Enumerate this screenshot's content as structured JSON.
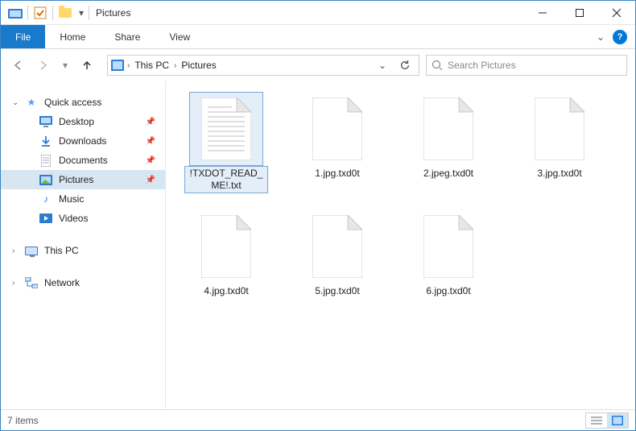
{
  "window": {
    "title": "Pictures"
  },
  "ribbon": {
    "file": "File",
    "tabs": [
      "Home",
      "Share",
      "View"
    ]
  },
  "breadcrumbs": [
    "This PC",
    "Pictures"
  ],
  "search": {
    "placeholder": "Search Pictures"
  },
  "sidebar": {
    "quick_access": {
      "label": "Quick access"
    },
    "items": [
      {
        "label": "Desktop",
        "pinned": true,
        "icon": "desktop"
      },
      {
        "label": "Downloads",
        "pinned": true,
        "icon": "downloads"
      },
      {
        "label": "Documents",
        "pinned": true,
        "icon": "documents"
      },
      {
        "label": "Pictures",
        "pinned": true,
        "icon": "pictures",
        "active": true
      },
      {
        "label": "Music",
        "pinned": false,
        "icon": "music"
      },
      {
        "label": "Videos",
        "pinned": false,
        "icon": "videos"
      }
    ],
    "this_pc": {
      "label": "This PC"
    },
    "network": {
      "label": "Network"
    }
  },
  "files": [
    {
      "name": "!TXDOT_READ_ME!.txt",
      "icon": "text",
      "selected": true
    },
    {
      "name": "1.jpg.txd0t",
      "icon": "blank"
    },
    {
      "name": "2.jpeg.txd0t",
      "icon": "blank"
    },
    {
      "name": "3.jpg.txd0t",
      "icon": "blank"
    },
    {
      "name": "4.jpg.txd0t",
      "icon": "blank"
    },
    {
      "name": "5.jpg.txd0t",
      "icon": "blank"
    },
    {
      "name": "6.jpg.txd0t",
      "icon": "blank"
    }
  ],
  "status": {
    "count_label": "7 items"
  }
}
